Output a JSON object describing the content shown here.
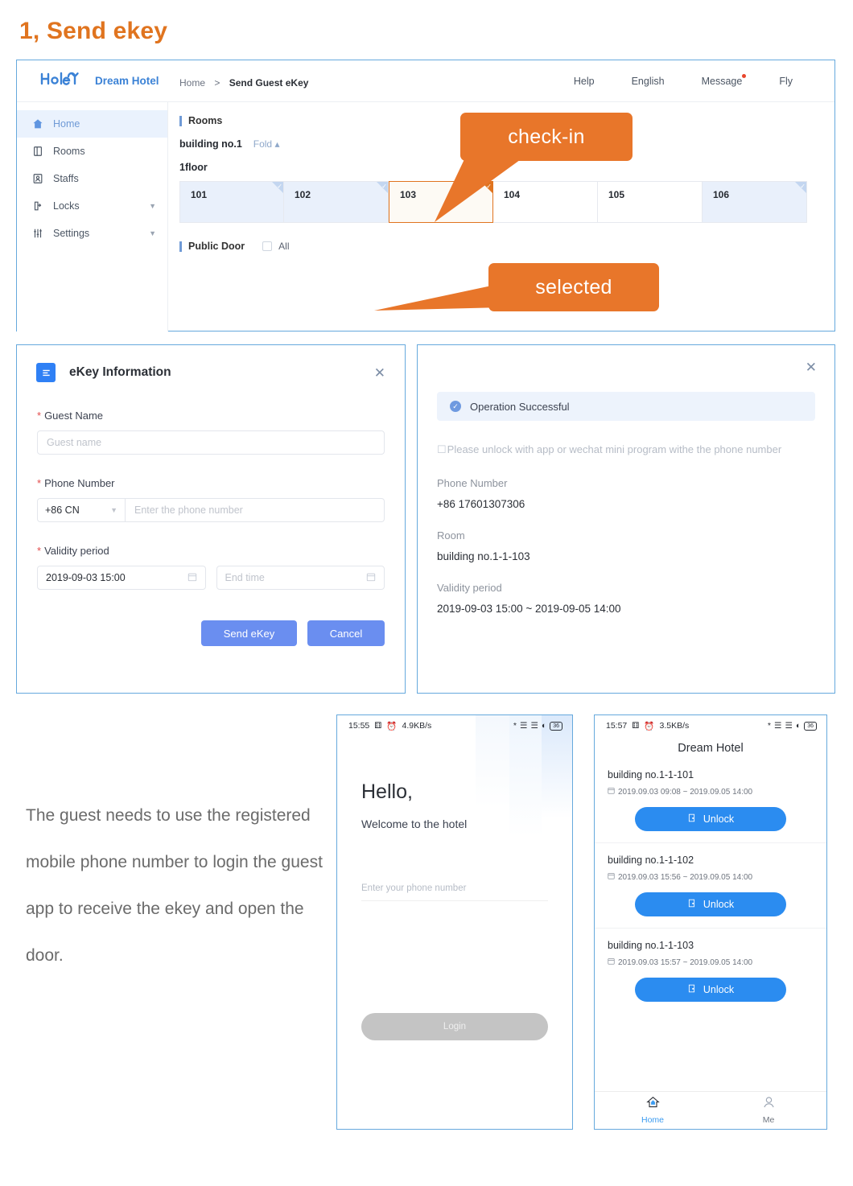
{
  "doc": {
    "title": "1, Send ekey"
  },
  "console": {
    "brand": {
      "name": "Dream Hotel",
      "logo_icon": "hotel-logo-icon"
    },
    "top_nav": [
      {
        "label": "Help",
        "name": "help"
      },
      {
        "label": "English",
        "name": "english"
      },
      {
        "label": "Message",
        "name": "message",
        "badge": true
      },
      {
        "label": "Fly",
        "name": "fly"
      }
    ],
    "sidebar": [
      {
        "label": "Home",
        "icon": "home-icon",
        "active": true
      },
      {
        "label": "Rooms",
        "icon": "rooms-icon",
        "active": false
      },
      {
        "label": "Staffs",
        "icon": "staffs-icon",
        "active": false
      },
      {
        "label": "Locks",
        "icon": "locks-icon",
        "active": false,
        "caret": true
      },
      {
        "label": "Settings",
        "icon": "settings-icon",
        "active": false,
        "caret": true
      }
    ],
    "breadcrumb": {
      "home": "Home",
      "sep": ">",
      "current": "Send Guest eKey"
    },
    "rooms_section": {
      "title": "Rooms",
      "building": "building no.1",
      "fold_label": "Fold",
      "floor": "1floor",
      "rooms": [
        {
          "number": "101",
          "state": "occupied"
        },
        {
          "number": "102",
          "state": "occupied"
        },
        {
          "number": "103",
          "state": "selected"
        },
        {
          "number": "104",
          "state": "free"
        },
        {
          "number": "105",
          "state": "free"
        },
        {
          "number": "106",
          "state": "occupied"
        }
      ]
    },
    "public_door": {
      "title": "Public Door",
      "all_label": "All",
      "checked": false
    }
  },
  "callouts": {
    "checkin": "check-in",
    "selected": "selected",
    "color": "#e8762a"
  },
  "ekey_dialog": {
    "title": "eKey Information",
    "icon": "document-icon",
    "close_icon": "close-icon",
    "guest_name": {
      "label": "Guest Name",
      "required": true,
      "value": "",
      "placeholder": "Guest name"
    },
    "phone_number": {
      "label": "Phone Number",
      "required": true,
      "country_code": "+86 CN",
      "value": "",
      "placeholder": "Enter the phone number"
    },
    "validity_period": {
      "label": "Validity period",
      "required": true,
      "start": "2019-09-03 15:00",
      "end": "",
      "end_placeholder": "End time"
    },
    "buttons": {
      "send": "Send eKey",
      "cancel": "Cancel",
      "color": "#6a8ef0"
    }
  },
  "success_dialog": {
    "close_icon": "close-icon",
    "alert": "Operation Successful",
    "note": "Please unlock with app or wechat mini program withe the phone number",
    "fields": [
      {
        "key": "Phone Number",
        "value": "+86 17601307306"
      },
      {
        "key": "Room",
        "value": "building no.1-1-103"
      },
      {
        "key": "Validity period",
        "value": "2019-09-03 15:00  ~  2019-09-05 14:00"
      }
    ]
  },
  "paragraph": "The guest needs to use the registered mobile phone number to login the guest app to receive the ekey and open the door.",
  "phone_login": {
    "status": {
      "time": "15:55",
      "speed": "4.9KB/s",
      "battery": "36"
    },
    "hello": "Hello,",
    "welcome": "Welcome to the hotel",
    "phone_placeholder": "Enter your phone number",
    "login_button": "Login"
  },
  "phone_list": {
    "status": {
      "time": "15:57",
      "speed": "3.5KB/s",
      "battery": "36"
    },
    "title": "Dream Hotel",
    "items": [
      {
        "name": "building no.1-1-101",
        "time": "2019.09.03 09:08 ~ 2019.09.05 14:00",
        "button": "Unlock"
      },
      {
        "name": "building no.1-1-102",
        "time": "2019.09.03 15:56 ~ 2019.09.05 14:00",
        "button": "Unlock"
      },
      {
        "name": "building no.1-1-103",
        "time": "2019.09.03 15:57 ~ 2019.09.05 14:00",
        "button": "Unlock"
      }
    ],
    "tabs": [
      {
        "label": "Home",
        "icon": "home-icon",
        "active": true
      },
      {
        "label": "Me",
        "icon": "person-icon",
        "active": false
      }
    ]
  }
}
